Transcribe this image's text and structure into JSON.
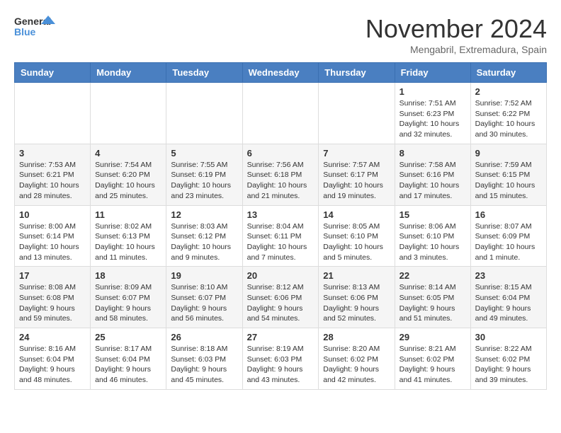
{
  "header": {
    "logo_line1": "General",
    "logo_line2": "Blue",
    "month": "November 2024",
    "location": "Mengabril, Extremadura, Spain"
  },
  "weekdays": [
    "Sunday",
    "Monday",
    "Tuesday",
    "Wednesday",
    "Thursday",
    "Friday",
    "Saturday"
  ],
  "weeks": [
    [
      {
        "day": "",
        "info": ""
      },
      {
        "day": "",
        "info": ""
      },
      {
        "day": "",
        "info": ""
      },
      {
        "day": "",
        "info": ""
      },
      {
        "day": "",
        "info": ""
      },
      {
        "day": "1",
        "info": "Sunrise: 7:51 AM\nSunset: 6:23 PM\nDaylight: 10 hours and 32 minutes."
      },
      {
        "day": "2",
        "info": "Sunrise: 7:52 AM\nSunset: 6:22 PM\nDaylight: 10 hours and 30 minutes."
      }
    ],
    [
      {
        "day": "3",
        "info": "Sunrise: 7:53 AM\nSunset: 6:21 PM\nDaylight: 10 hours and 28 minutes."
      },
      {
        "day": "4",
        "info": "Sunrise: 7:54 AM\nSunset: 6:20 PM\nDaylight: 10 hours and 25 minutes."
      },
      {
        "day": "5",
        "info": "Sunrise: 7:55 AM\nSunset: 6:19 PM\nDaylight: 10 hours and 23 minutes."
      },
      {
        "day": "6",
        "info": "Sunrise: 7:56 AM\nSunset: 6:18 PM\nDaylight: 10 hours and 21 minutes."
      },
      {
        "day": "7",
        "info": "Sunrise: 7:57 AM\nSunset: 6:17 PM\nDaylight: 10 hours and 19 minutes."
      },
      {
        "day": "8",
        "info": "Sunrise: 7:58 AM\nSunset: 6:16 PM\nDaylight: 10 hours and 17 minutes."
      },
      {
        "day": "9",
        "info": "Sunrise: 7:59 AM\nSunset: 6:15 PM\nDaylight: 10 hours and 15 minutes."
      }
    ],
    [
      {
        "day": "10",
        "info": "Sunrise: 8:00 AM\nSunset: 6:14 PM\nDaylight: 10 hours and 13 minutes."
      },
      {
        "day": "11",
        "info": "Sunrise: 8:02 AM\nSunset: 6:13 PM\nDaylight: 10 hours and 11 minutes."
      },
      {
        "day": "12",
        "info": "Sunrise: 8:03 AM\nSunset: 6:12 PM\nDaylight: 10 hours and 9 minutes."
      },
      {
        "day": "13",
        "info": "Sunrise: 8:04 AM\nSunset: 6:11 PM\nDaylight: 10 hours and 7 minutes."
      },
      {
        "day": "14",
        "info": "Sunrise: 8:05 AM\nSunset: 6:10 PM\nDaylight: 10 hours and 5 minutes."
      },
      {
        "day": "15",
        "info": "Sunrise: 8:06 AM\nSunset: 6:10 PM\nDaylight: 10 hours and 3 minutes."
      },
      {
        "day": "16",
        "info": "Sunrise: 8:07 AM\nSunset: 6:09 PM\nDaylight: 10 hours and 1 minute."
      }
    ],
    [
      {
        "day": "17",
        "info": "Sunrise: 8:08 AM\nSunset: 6:08 PM\nDaylight: 9 hours and 59 minutes."
      },
      {
        "day": "18",
        "info": "Sunrise: 8:09 AM\nSunset: 6:07 PM\nDaylight: 9 hours and 58 minutes."
      },
      {
        "day": "19",
        "info": "Sunrise: 8:10 AM\nSunset: 6:07 PM\nDaylight: 9 hours and 56 minutes."
      },
      {
        "day": "20",
        "info": "Sunrise: 8:12 AM\nSunset: 6:06 PM\nDaylight: 9 hours and 54 minutes."
      },
      {
        "day": "21",
        "info": "Sunrise: 8:13 AM\nSunset: 6:06 PM\nDaylight: 9 hours and 52 minutes."
      },
      {
        "day": "22",
        "info": "Sunrise: 8:14 AM\nSunset: 6:05 PM\nDaylight: 9 hours and 51 minutes."
      },
      {
        "day": "23",
        "info": "Sunrise: 8:15 AM\nSunset: 6:04 PM\nDaylight: 9 hours and 49 minutes."
      }
    ],
    [
      {
        "day": "24",
        "info": "Sunrise: 8:16 AM\nSunset: 6:04 PM\nDaylight: 9 hours and 48 minutes."
      },
      {
        "day": "25",
        "info": "Sunrise: 8:17 AM\nSunset: 6:04 PM\nDaylight: 9 hours and 46 minutes."
      },
      {
        "day": "26",
        "info": "Sunrise: 8:18 AM\nSunset: 6:03 PM\nDaylight: 9 hours and 45 minutes."
      },
      {
        "day": "27",
        "info": "Sunrise: 8:19 AM\nSunset: 6:03 PM\nDaylight: 9 hours and 43 minutes."
      },
      {
        "day": "28",
        "info": "Sunrise: 8:20 AM\nSunset: 6:02 PM\nDaylight: 9 hours and 42 minutes."
      },
      {
        "day": "29",
        "info": "Sunrise: 8:21 AM\nSunset: 6:02 PM\nDaylight: 9 hours and 41 minutes."
      },
      {
        "day": "30",
        "info": "Sunrise: 8:22 AM\nSunset: 6:02 PM\nDaylight: 9 hours and 39 minutes."
      }
    ]
  ]
}
